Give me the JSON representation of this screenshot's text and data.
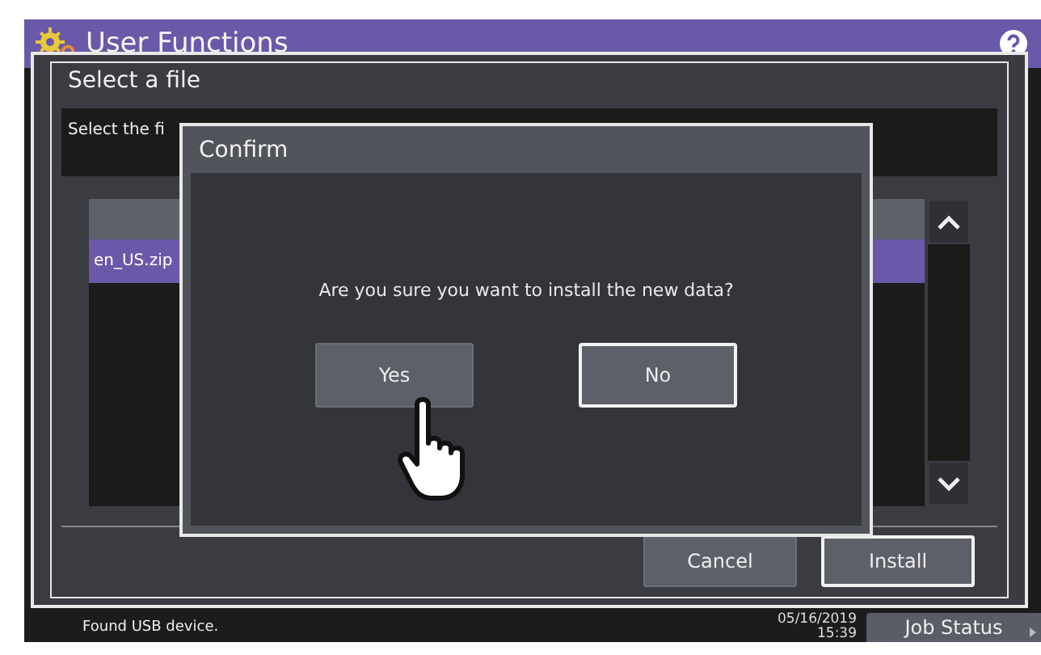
{
  "header": {
    "title": "User Functions"
  },
  "file_dialog": {
    "title": "Select a file",
    "instruction": "Select the fi",
    "files": [
      {
        "name": "en_US.zip",
        "selected": true
      }
    ],
    "buttons": [
      {
        "label": "Cancel",
        "default": false
      },
      {
        "label": "Install",
        "default": true
      }
    ]
  },
  "confirm": {
    "title": "Confirm",
    "message": "Are you sure you want to install the new data?",
    "buttons": [
      {
        "label": "Yes",
        "default": false
      },
      {
        "label": "No",
        "default": true
      }
    ]
  },
  "status_bar": {
    "message": "Found USB device.",
    "date": "05/16/2019",
    "time": "15:39",
    "job_status": "Job Status"
  }
}
